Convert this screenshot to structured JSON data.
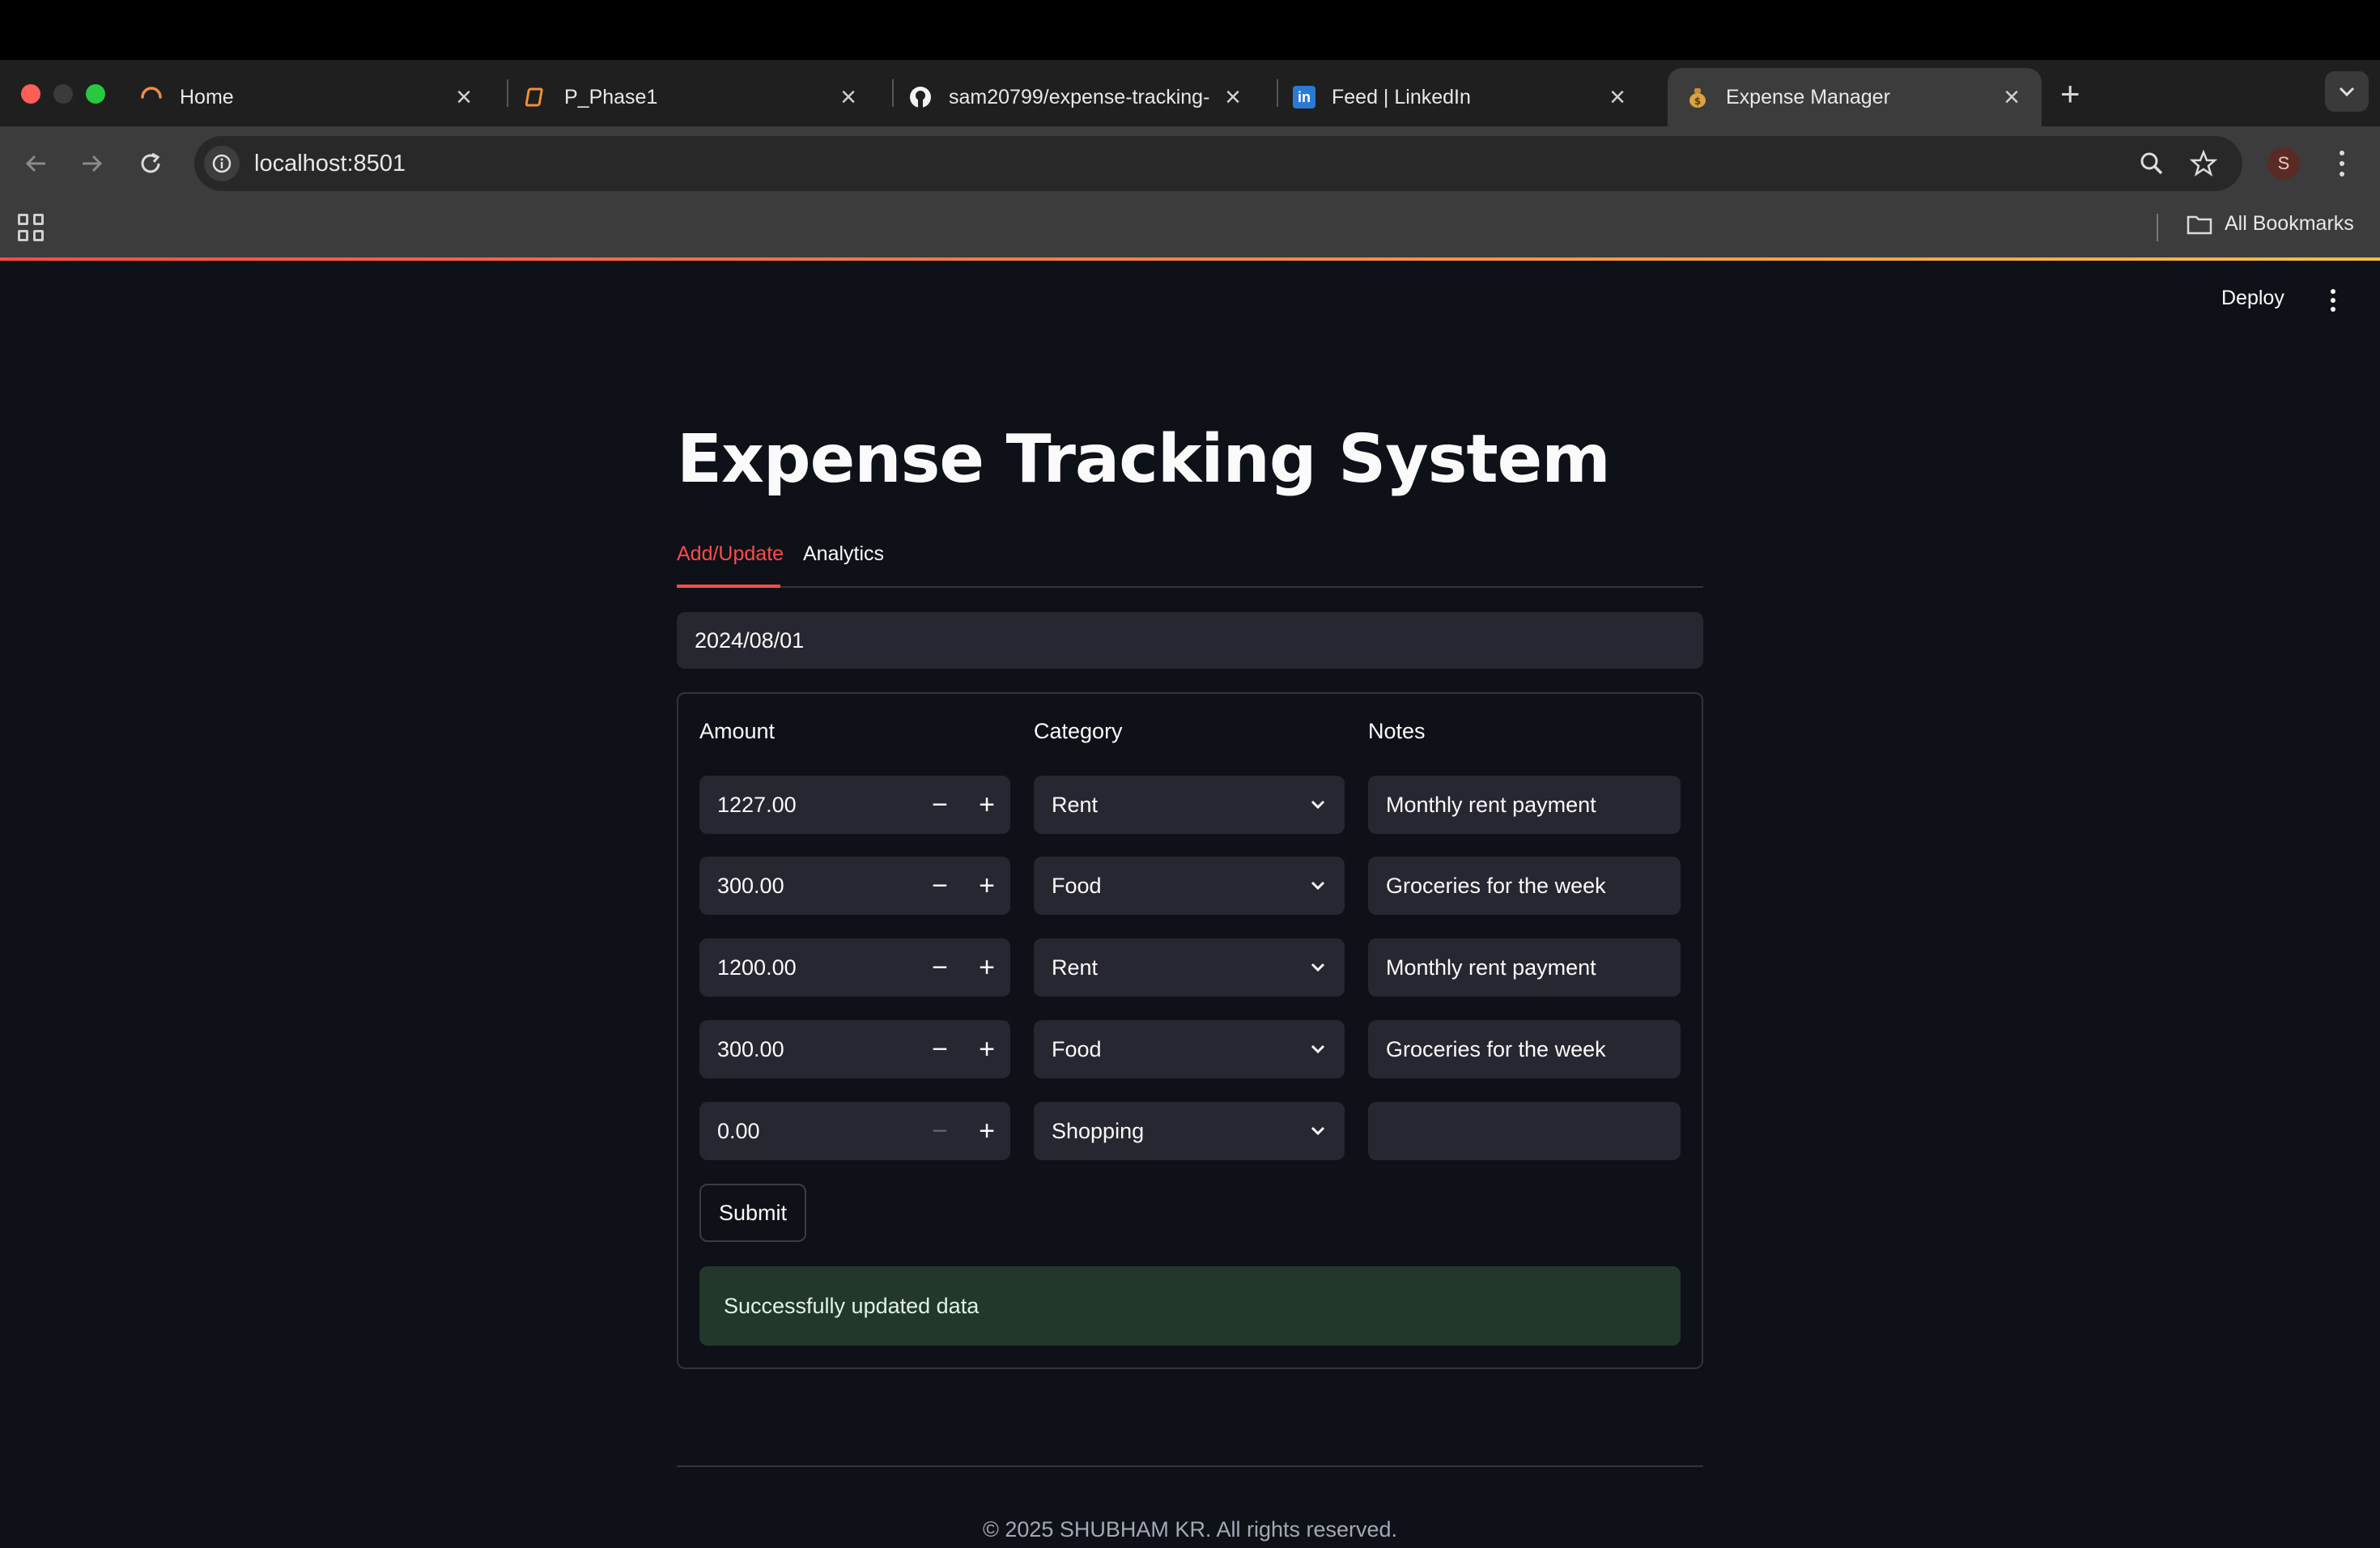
{
  "browser": {
    "tabs": [
      {
        "label": "Home",
        "icon": "loading-spinner-icon"
      },
      {
        "label": "P_Phase1",
        "icon": "notebook-icon"
      },
      {
        "label": "sam20799/expense-tracking-",
        "icon": "github-icon"
      },
      {
        "label": "Feed | LinkedIn",
        "icon": "linkedin-icon"
      },
      {
        "label": "Expense Manager",
        "icon": "money-bag-icon"
      }
    ],
    "url": "localhost:8501",
    "profile_initial": "S",
    "bookmarks_label": "All Bookmarks"
  },
  "app": {
    "deploy_label": "Deploy",
    "title": "Expense Tracking System",
    "tabs": [
      "Add/Update",
      "Analytics"
    ],
    "active_tab": 0,
    "date_value": "2024/08/01",
    "columns": {
      "amount": "Amount",
      "category": "Category",
      "notes": "Notes"
    },
    "rows": [
      {
        "amount": "1227.00",
        "category": "Rent",
        "notes": "Monthly rent payment"
      },
      {
        "amount": "300.00",
        "category": "Food",
        "notes": "Groceries for the week"
      },
      {
        "amount": "1200.00",
        "category": "Rent",
        "notes": "Monthly rent payment"
      },
      {
        "amount": "300.00",
        "category": "Food",
        "notes": "Groceries for the week"
      },
      {
        "amount": "0.00",
        "category": "Shopping",
        "notes": ""
      }
    ],
    "submit_label": "Submit",
    "success_message": "Successfully updated data",
    "footer": "© 2025 SHUBHAM KR. All rights reserved."
  },
  "colors": {
    "background": "#0e1117",
    "accent": "#ff4b4b",
    "input_bg": "#262730",
    "success_bg": "#21382b"
  }
}
